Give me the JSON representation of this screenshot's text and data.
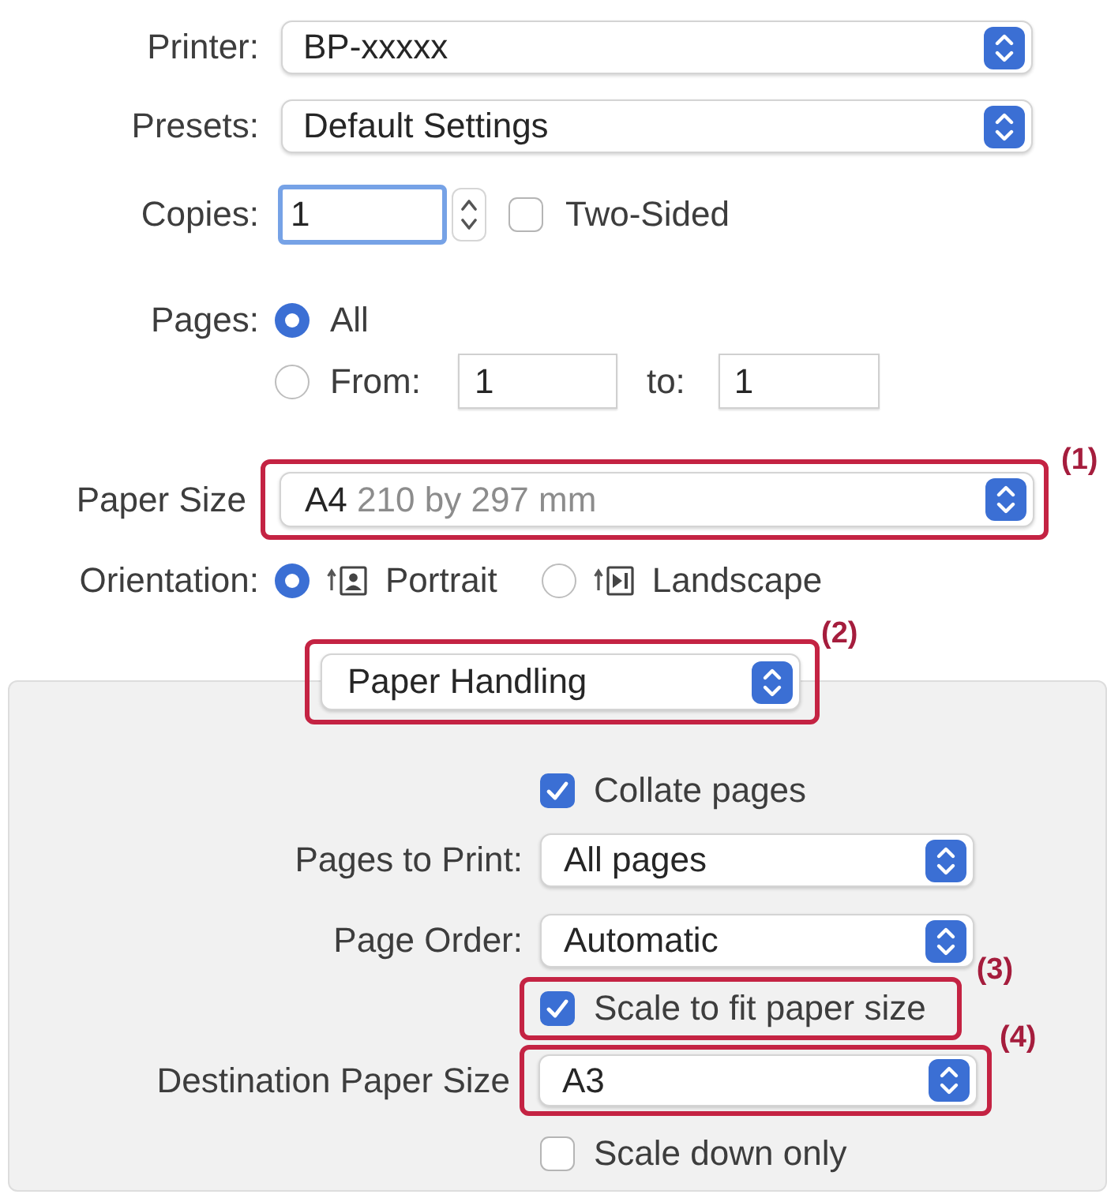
{
  "printer": {
    "label": "Printer:",
    "value": "BP-xxxxx"
  },
  "presets": {
    "label": "Presets:",
    "value": "Default Settings"
  },
  "copies": {
    "label": "Copies:",
    "value": "1",
    "focused": true
  },
  "two_sided": {
    "label": "Two-Sided",
    "checked": false
  },
  "pages": {
    "label": "Pages:",
    "options": [
      {
        "kind": "all",
        "label": "All",
        "selected": true
      },
      {
        "kind": "range",
        "label": "From:",
        "selected": false,
        "from": "1",
        "to_label": "to:",
        "to": "1"
      }
    ]
  },
  "paper_size": {
    "label": "Paper Size",
    "value": "A4",
    "detail": "210 by 297 mm",
    "callout": "(1)"
  },
  "orientation": {
    "label": "Orientation:",
    "options": [
      {
        "kind": "portrait",
        "label": "Portrait",
        "selected": true
      },
      {
        "kind": "landscape",
        "label": "Landscape",
        "selected": false
      }
    ]
  },
  "section_menu": {
    "value": "Paper Handling",
    "callout": "(2)"
  },
  "panel": {
    "items": [
      {
        "kind": "checkbox",
        "label": "Collate pages",
        "checked": true
      },
      {
        "kind": "dropdown",
        "label": "Pages to Print:",
        "value": "All pages"
      },
      {
        "kind": "dropdown",
        "label": "Page Order:",
        "value": "Automatic"
      },
      {
        "kind": "checkbox",
        "label": "Scale to fit paper size",
        "checked": true,
        "callout": "(3)"
      },
      {
        "kind": "dropdown",
        "label": "Destination Paper Size",
        "value": "A3",
        "callout": "(4)"
      },
      {
        "kind": "checkbox",
        "label": "Scale down only",
        "checked": false
      }
    ]
  }
}
